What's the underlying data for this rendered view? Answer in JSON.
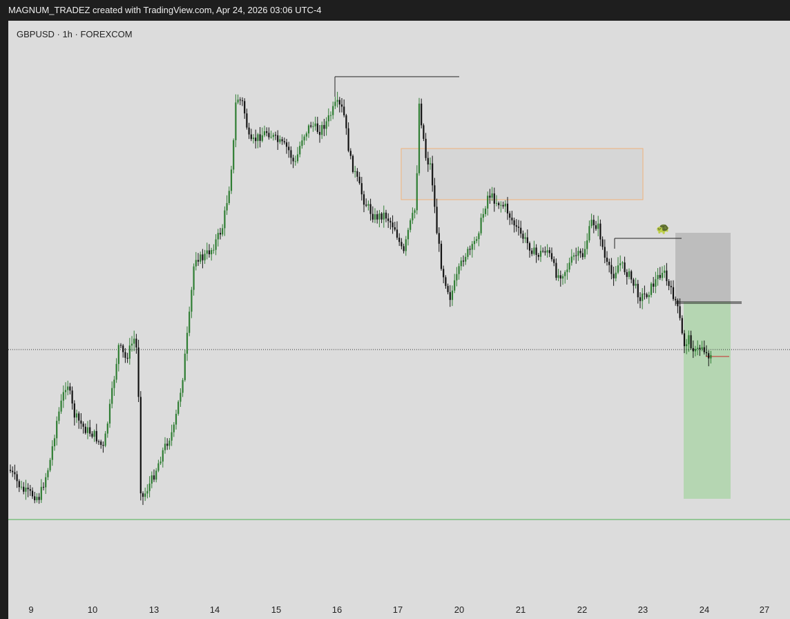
{
  "header": {
    "title": "MAGNUM_TRADEZ created with TradingView.com, Apr 24, 2026 03:06 UTC-4"
  },
  "symbol_line": "GBPUSD · 1h · FOREXCOM",
  "chart_data": {
    "type": "candlestick",
    "symbol": "GBPUSD",
    "interval": "1h",
    "exchange": "FOREXCOM",
    "x_ticks": [
      "9",
      "10",
      "13",
      "14",
      "15",
      "16",
      "17",
      "20",
      "21",
      "22",
      "23",
      "24",
      "27"
    ],
    "y_range": [
      1.3365,
      1.3615
    ],
    "grid": false,
    "up_color": "#2e7d32",
    "down_color": "#111111",
    "current_price_note": "dotted current price line",
    "zones": [
      {
        "name": "supply-zone",
        "color": "#d8d2cc",
        "border": "#f0b27a"
      },
      {
        "name": "risk-zone",
        "color": "#bdbdbd"
      },
      {
        "name": "reward-zone",
        "color": "#b5d6b2"
      }
    ]
  }
}
